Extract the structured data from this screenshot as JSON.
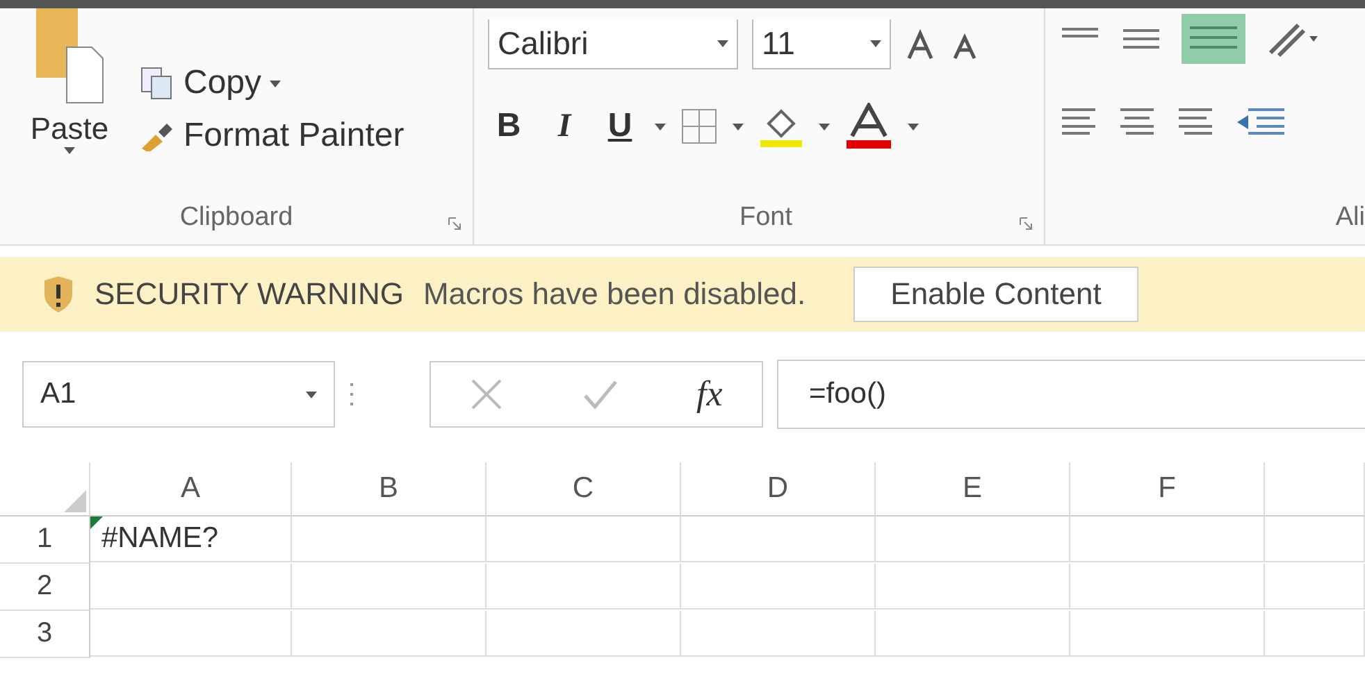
{
  "ribbon": {
    "clipboard": {
      "paste_label": "Paste",
      "items": [
        {
          "kind": "copy",
          "label": "Copy"
        },
        {
          "kind": "painter",
          "label": "Format Painter"
        }
      ],
      "group_label": "Clipboard"
    },
    "font": {
      "font_name": "Calibri",
      "font_size": "11",
      "style_buttons": [
        "B",
        "I",
        "U"
      ],
      "group_label": "Font"
    },
    "alignment": {
      "group_label": "Ali"
    }
  },
  "security_bar": {
    "title": "SECURITY WARNING",
    "message": "Macros have been disabled.",
    "button": "Enable Content"
  },
  "formula_bar": {
    "name_box": "A1",
    "fx": "fx",
    "formula": "=foo()"
  },
  "grid": {
    "columns": [
      "A",
      "B",
      "C",
      "D",
      "E",
      "F"
    ],
    "rows": [
      {
        "header": "1",
        "cells": [
          {
            "value": "#NAME?",
            "error_flag": true
          }
        ]
      },
      {
        "header": "2",
        "cells": []
      },
      {
        "header": "3",
        "cells": []
      }
    ]
  }
}
